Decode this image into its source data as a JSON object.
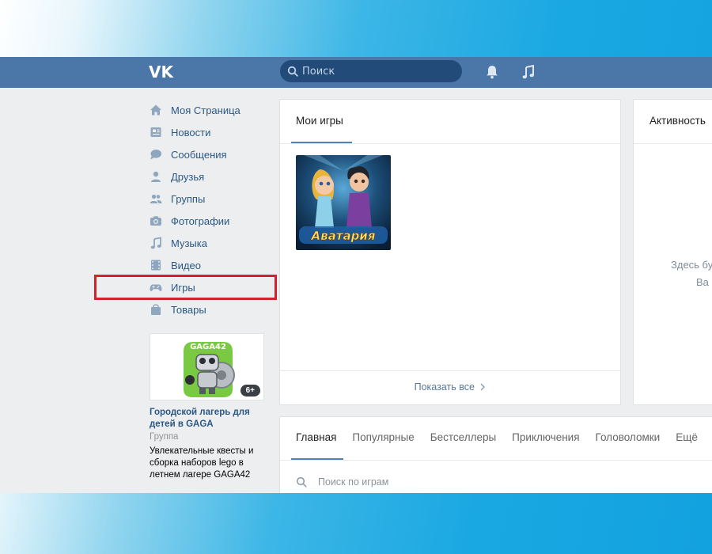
{
  "header": {
    "logo": "VK",
    "search_placeholder": "Поиск",
    "icons": {
      "search": "search-icon",
      "notifications": "bell-icon",
      "music": "music-note-icon"
    }
  },
  "sidebar": {
    "items": [
      {
        "label": "Моя Страница",
        "icon": "home-icon"
      },
      {
        "label": "Новости",
        "icon": "newspaper-icon"
      },
      {
        "label": "Сообщения",
        "icon": "chat-bubble-icon"
      },
      {
        "label": "Друзья",
        "icon": "person-icon"
      },
      {
        "label": "Группы",
        "icon": "people-icon"
      },
      {
        "label": "Фотографии",
        "icon": "camera-icon"
      },
      {
        "label": "Музыка",
        "icon": "music-note-icon"
      },
      {
        "label": "Видео",
        "icon": "film-icon"
      },
      {
        "label": "Игры",
        "icon": "gamepad-icon"
      },
      {
        "label": "Товары",
        "icon": "shopping-bag-icon"
      }
    ],
    "highlighted_item": "Игры",
    "highlight_color": "#d4222a"
  },
  "ad": {
    "image_text": "GAGA42",
    "age_badge": "6+",
    "title": "Городской лагерь для детей в GAGA",
    "type": "Группа",
    "description": "Увлекательные квесты и сборка наборов lego в летнем лагере GAGA42"
  },
  "my_games": {
    "title": "Мои игры",
    "games": [
      {
        "name": "Аватария"
      }
    ],
    "show_all": "Показать все"
  },
  "activity": {
    "title": "Активность",
    "empty_line1": "Здесь бу",
    "empty_line2": "Ва"
  },
  "catalog": {
    "tabs": [
      "Главная",
      "Популярные",
      "Бестселлеры",
      "Приключения",
      "Головоломки",
      "Ещё"
    ],
    "active_tab": "Главная",
    "search_placeholder": "Поиск по играм"
  },
  "colors": {
    "header_bg": "#4a76a8",
    "search_bg": "#224b7a",
    "link": "#2a5885",
    "accent": "#5181b8",
    "page_bg": "#edeef0"
  }
}
